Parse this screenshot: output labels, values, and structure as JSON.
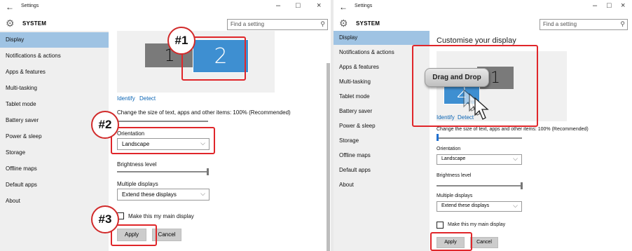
{
  "window": {
    "title": "Settings",
    "back_glyph": "←",
    "minimize": "–",
    "maximize": "□",
    "close": "×"
  },
  "header": {
    "section": "SYSTEM",
    "search_placeholder": "Find a setting"
  },
  "sidebar": {
    "items": [
      {
        "label": "Display"
      },
      {
        "label": "Notifications & actions"
      },
      {
        "label": "Apps & features"
      },
      {
        "label": "Multi-tasking"
      },
      {
        "label": "Tablet mode"
      },
      {
        "label": "Battery saver"
      },
      {
        "label": "Power & sleep"
      },
      {
        "label": "Storage"
      },
      {
        "label": "Offline maps"
      },
      {
        "label": "Default apps"
      },
      {
        "label": "About"
      }
    ]
  },
  "display": {
    "heading": "Customise your display",
    "monitors": {
      "first": "1",
      "second": "2"
    },
    "identify": "Identify",
    "detect": "Detect",
    "scale_label": "Change the size of text, apps and other items: 100% (Recommended)",
    "orientation_label": "Orientation",
    "orientation_value": "Landscape",
    "brightness_label": "Brightness level",
    "multiple_label": "Multiple displays",
    "multiple_value": "Extend these displays",
    "main_display_label": "Make this my main display",
    "apply": "Apply",
    "cancel": "Cancel"
  },
  "annotations": {
    "marker1": "#1",
    "marker2": "#2",
    "marker3": "#3",
    "callout": "Drag and Drop"
  },
  "colors": {
    "accent_nav": "#9fc3e3",
    "monitor_blue": "#3e8fd1",
    "annotation_red": "#e0262a"
  }
}
